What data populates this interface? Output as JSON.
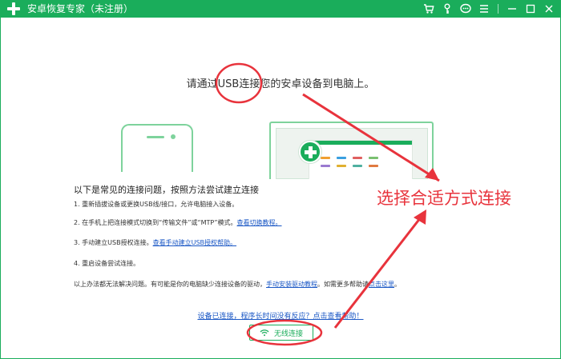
{
  "window": {
    "title": "安卓恢复专家（未注册）",
    "icons": [
      "cart-icon",
      "key-icon",
      "chat-icon",
      "menu-icon",
      "minimize-icon",
      "maximize-icon",
      "close-icon"
    ]
  },
  "main": {
    "headline": "请通过USB连接您的安卓设备到电脑上。",
    "intro": "以下是常见的连接问题，按照方法尝试建立连接",
    "steps": [
      {
        "text": "1.  重新插拔设备或更换USB线/接口，允许电脑接入设备。",
        "link": ""
      },
      {
        "text": "2.  在手机上把连接模式切换到“传输文件”或“MTP”模式。",
        "link": "查看切换教程。"
      },
      {
        "text": "3.  手动建立USB授权连接。",
        "link": "查看手动建立USB授权帮助。"
      },
      {
        "text": "4.  重启设备尝试连接。",
        "link": ""
      }
    ],
    "note": {
      "text_before": "以上办法都无法解决问题。有可能是你的电脑缺少连接设备的驱动，",
      "driver_link": "手动安装驱动教程",
      "text_middle": "。如需更多帮助请",
      "here_link": "点击这里",
      "text_after": "。"
    },
    "help_link": "设备已连接，程序长时间没有反应？点击查看帮助！",
    "wifi_button": "无线连接"
  },
  "annotation": {
    "label": "选择合适方式连接",
    "color": "#e8333c"
  },
  "colors": {
    "brand": "#1aad5b",
    "link": "#1a57c5",
    "annotation": "#e8333c"
  }
}
